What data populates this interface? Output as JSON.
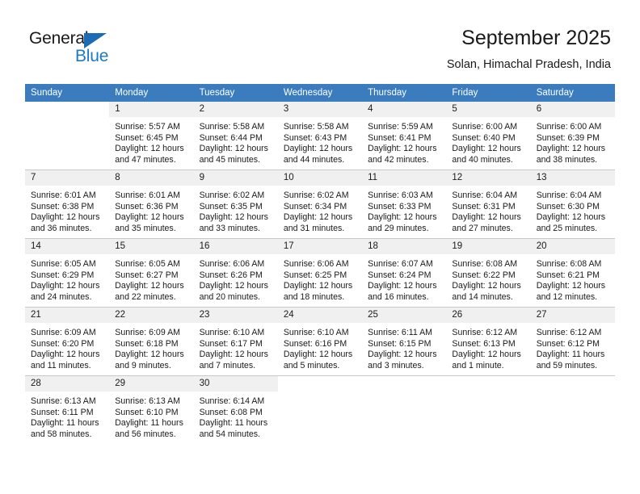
{
  "logo": {
    "word_top": "General",
    "word_bottom": "Blue",
    "triangle_color": "#1b6cb5",
    "blue_color": "#1b7bc4"
  },
  "header": {
    "title": "September 2025",
    "subtitle": "Solan, Himachal Pradesh, India"
  },
  "theme": {
    "header_row_bg": "#3a7cbe",
    "daynum_bg": "#f0f0f0",
    "grid_line": "#c8c8c8",
    "text": "#1a1a1a"
  },
  "weekday_headers": [
    "Sunday",
    "Monday",
    "Tuesday",
    "Wednesday",
    "Thursday",
    "Friday",
    "Saturday"
  ],
  "weeks": [
    [
      {
        "day": "",
        "sunrise": "",
        "sunset": "",
        "daylight_1": "",
        "daylight_2": "",
        "blank": true
      },
      {
        "day": "1",
        "sunrise": "Sunrise: 5:57 AM",
        "sunset": "Sunset: 6:45 PM",
        "daylight_1": "Daylight: 12 hours",
        "daylight_2": "and 47 minutes."
      },
      {
        "day": "2",
        "sunrise": "Sunrise: 5:58 AM",
        "sunset": "Sunset: 6:44 PM",
        "daylight_1": "Daylight: 12 hours",
        "daylight_2": "and 45 minutes."
      },
      {
        "day": "3",
        "sunrise": "Sunrise: 5:58 AM",
        "sunset": "Sunset: 6:43 PM",
        "daylight_1": "Daylight: 12 hours",
        "daylight_2": "and 44 minutes."
      },
      {
        "day": "4",
        "sunrise": "Sunrise: 5:59 AM",
        "sunset": "Sunset: 6:41 PM",
        "daylight_1": "Daylight: 12 hours",
        "daylight_2": "and 42 minutes."
      },
      {
        "day": "5",
        "sunrise": "Sunrise: 6:00 AM",
        "sunset": "Sunset: 6:40 PM",
        "daylight_1": "Daylight: 12 hours",
        "daylight_2": "and 40 minutes."
      },
      {
        "day": "6",
        "sunrise": "Sunrise: 6:00 AM",
        "sunset": "Sunset: 6:39 PM",
        "daylight_1": "Daylight: 12 hours",
        "daylight_2": "and 38 minutes."
      }
    ],
    [
      {
        "day": "7",
        "sunrise": "Sunrise: 6:01 AM",
        "sunset": "Sunset: 6:38 PM",
        "daylight_1": "Daylight: 12 hours",
        "daylight_2": "and 36 minutes."
      },
      {
        "day": "8",
        "sunrise": "Sunrise: 6:01 AM",
        "sunset": "Sunset: 6:36 PM",
        "daylight_1": "Daylight: 12 hours",
        "daylight_2": "and 35 minutes."
      },
      {
        "day": "9",
        "sunrise": "Sunrise: 6:02 AM",
        "sunset": "Sunset: 6:35 PM",
        "daylight_1": "Daylight: 12 hours",
        "daylight_2": "and 33 minutes."
      },
      {
        "day": "10",
        "sunrise": "Sunrise: 6:02 AM",
        "sunset": "Sunset: 6:34 PM",
        "daylight_1": "Daylight: 12 hours",
        "daylight_2": "and 31 minutes."
      },
      {
        "day": "11",
        "sunrise": "Sunrise: 6:03 AM",
        "sunset": "Sunset: 6:33 PM",
        "daylight_1": "Daylight: 12 hours",
        "daylight_2": "and 29 minutes."
      },
      {
        "day": "12",
        "sunrise": "Sunrise: 6:04 AM",
        "sunset": "Sunset: 6:31 PM",
        "daylight_1": "Daylight: 12 hours",
        "daylight_2": "and 27 minutes."
      },
      {
        "day": "13",
        "sunrise": "Sunrise: 6:04 AM",
        "sunset": "Sunset: 6:30 PM",
        "daylight_1": "Daylight: 12 hours",
        "daylight_2": "and 25 minutes."
      }
    ],
    [
      {
        "day": "14",
        "sunrise": "Sunrise: 6:05 AM",
        "sunset": "Sunset: 6:29 PM",
        "daylight_1": "Daylight: 12 hours",
        "daylight_2": "and 24 minutes."
      },
      {
        "day": "15",
        "sunrise": "Sunrise: 6:05 AM",
        "sunset": "Sunset: 6:27 PM",
        "daylight_1": "Daylight: 12 hours",
        "daylight_2": "and 22 minutes."
      },
      {
        "day": "16",
        "sunrise": "Sunrise: 6:06 AM",
        "sunset": "Sunset: 6:26 PM",
        "daylight_1": "Daylight: 12 hours",
        "daylight_2": "and 20 minutes."
      },
      {
        "day": "17",
        "sunrise": "Sunrise: 6:06 AM",
        "sunset": "Sunset: 6:25 PM",
        "daylight_1": "Daylight: 12 hours",
        "daylight_2": "and 18 minutes."
      },
      {
        "day": "18",
        "sunrise": "Sunrise: 6:07 AM",
        "sunset": "Sunset: 6:24 PM",
        "daylight_1": "Daylight: 12 hours",
        "daylight_2": "and 16 minutes."
      },
      {
        "day": "19",
        "sunrise": "Sunrise: 6:08 AM",
        "sunset": "Sunset: 6:22 PM",
        "daylight_1": "Daylight: 12 hours",
        "daylight_2": "and 14 minutes."
      },
      {
        "day": "20",
        "sunrise": "Sunrise: 6:08 AM",
        "sunset": "Sunset: 6:21 PM",
        "daylight_1": "Daylight: 12 hours",
        "daylight_2": "and 12 minutes."
      }
    ],
    [
      {
        "day": "21",
        "sunrise": "Sunrise: 6:09 AM",
        "sunset": "Sunset: 6:20 PM",
        "daylight_1": "Daylight: 12 hours",
        "daylight_2": "and 11 minutes."
      },
      {
        "day": "22",
        "sunrise": "Sunrise: 6:09 AM",
        "sunset": "Sunset: 6:18 PM",
        "daylight_1": "Daylight: 12 hours",
        "daylight_2": "and 9 minutes."
      },
      {
        "day": "23",
        "sunrise": "Sunrise: 6:10 AM",
        "sunset": "Sunset: 6:17 PM",
        "daylight_1": "Daylight: 12 hours",
        "daylight_2": "and 7 minutes."
      },
      {
        "day": "24",
        "sunrise": "Sunrise: 6:10 AM",
        "sunset": "Sunset: 6:16 PM",
        "daylight_1": "Daylight: 12 hours",
        "daylight_2": "and 5 minutes."
      },
      {
        "day": "25",
        "sunrise": "Sunrise: 6:11 AM",
        "sunset": "Sunset: 6:15 PM",
        "daylight_1": "Daylight: 12 hours",
        "daylight_2": "and 3 minutes."
      },
      {
        "day": "26",
        "sunrise": "Sunrise: 6:12 AM",
        "sunset": "Sunset: 6:13 PM",
        "daylight_1": "Daylight: 12 hours",
        "daylight_2": "and 1 minute."
      },
      {
        "day": "27",
        "sunrise": "Sunrise: 6:12 AM",
        "sunset": "Sunset: 6:12 PM",
        "daylight_1": "Daylight: 11 hours",
        "daylight_2": "and 59 minutes."
      }
    ],
    [
      {
        "day": "28",
        "sunrise": "Sunrise: 6:13 AM",
        "sunset": "Sunset: 6:11 PM",
        "daylight_1": "Daylight: 11 hours",
        "daylight_2": "and 58 minutes."
      },
      {
        "day": "29",
        "sunrise": "Sunrise: 6:13 AM",
        "sunset": "Sunset: 6:10 PM",
        "daylight_1": "Daylight: 11 hours",
        "daylight_2": "and 56 minutes."
      },
      {
        "day": "30",
        "sunrise": "Sunrise: 6:14 AM",
        "sunset": "Sunset: 6:08 PM",
        "daylight_1": "Daylight: 11 hours",
        "daylight_2": "and 54 minutes."
      },
      {
        "day": "",
        "sunrise": "",
        "sunset": "",
        "daylight_1": "",
        "daylight_2": "",
        "blank": true
      },
      {
        "day": "",
        "sunrise": "",
        "sunset": "",
        "daylight_1": "",
        "daylight_2": "",
        "blank": true
      },
      {
        "day": "",
        "sunrise": "",
        "sunset": "",
        "daylight_1": "",
        "daylight_2": "",
        "blank": true
      },
      {
        "day": "",
        "sunrise": "",
        "sunset": "",
        "daylight_1": "",
        "daylight_2": "",
        "blank": true
      }
    ]
  ]
}
